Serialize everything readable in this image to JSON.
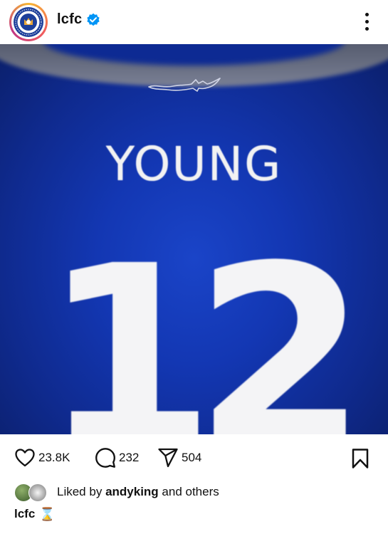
{
  "header": {
    "username": "lcfc",
    "verified": true,
    "more_icon": "more-vertical-icon",
    "avatar_icon": "leicester-city-crest-icon"
  },
  "post": {
    "jersey_name": "YOUNG",
    "jersey_number": "12",
    "shirt_color": "#1337b3",
    "crest_icon": "fox-crest-icon"
  },
  "actions": {
    "likes": "23.8K",
    "comments": "232",
    "shares": "504",
    "like_icon": "heart-icon",
    "comment_icon": "comment-icon",
    "share_icon": "send-icon",
    "save_icon": "bookmark-icon"
  },
  "liked_by": {
    "prefix": "Liked by",
    "user": "andyking",
    "suffix": "and others"
  },
  "caption": {
    "user": "lcfc",
    "emoji": "⌛"
  },
  "colors": {
    "verified_blue": "#0095f6",
    "text": "#111111"
  }
}
